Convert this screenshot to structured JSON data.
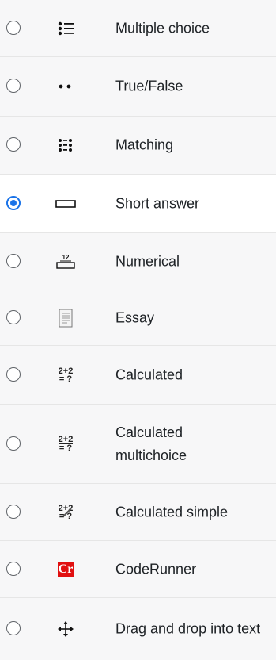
{
  "question_types": [
    {
      "label": "Multiple choice",
      "icon": "multiple-choice-icon",
      "selected": false
    },
    {
      "label": "True/False",
      "icon": "true-false-icon",
      "selected": false
    },
    {
      "label": "Matching",
      "icon": "matching-icon",
      "selected": false
    },
    {
      "label": "Short answer",
      "icon": "short-answer-icon",
      "selected": true
    },
    {
      "label": "Numerical",
      "icon": "numerical-icon",
      "icon_text": "12",
      "selected": false
    },
    {
      "label": "Essay",
      "icon": "essay-icon",
      "selected": false
    },
    {
      "label": "Calculated",
      "icon": "calculated-icon",
      "icon_text_top": "2+2",
      "icon_text_bottom": "= ?",
      "selected": false
    },
    {
      "label": "Calculated multichoice",
      "icon": "calculated-multichoice-icon",
      "icon_text_top": "2+2",
      "icon_text_bottom": "= ?",
      "selected": false
    },
    {
      "label": "Calculated simple",
      "icon": "calculated-simple-icon",
      "icon_text_top": "2+2",
      "icon_text_bottom": "= ?",
      "selected": false
    },
    {
      "label": "CodeRunner",
      "icon": "coderunner-icon",
      "icon_text": "Cr",
      "selected": false
    },
    {
      "label": "Drag and drop into text",
      "icon": "drag-and-drop-icon",
      "selected": false
    }
  ],
  "colors": {
    "radio_selected": "#1a73e8",
    "selected_row_bg": "#ffffff",
    "row_bg": "#f7f7f8",
    "coderunner_badge": "#e11010"
  }
}
